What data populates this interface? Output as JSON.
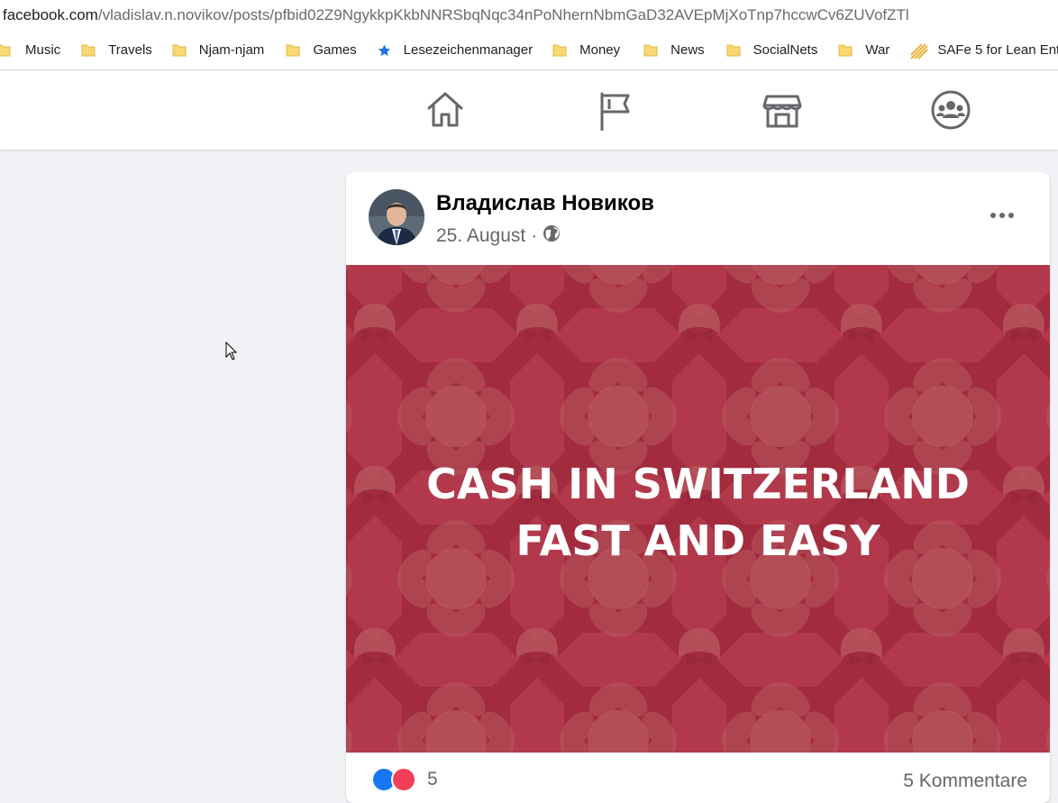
{
  "browser": {
    "url_host": "facebook.com",
    "url_path": "/vladislav.n.novikov/posts/pfbid02Z9NgykkpKkbNNRSbqNqc34nPoNhernNbmGaD32AVEpMjXoTnp7hccwCv6ZUVofZTl"
  },
  "bookmarks": [
    {
      "label": "Music",
      "icon": "folder-icon"
    },
    {
      "label": "Travels",
      "icon": "folder-icon"
    },
    {
      "label": "Njam-njam",
      "icon": "folder-icon"
    },
    {
      "label": "Games",
      "icon": "folder-icon"
    },
    {
      "label": "Lesezeichenmanager",
      "icon": "star-icon"
    },
    {
      "label": "Money",
      "icon": "folder-icon"
    },
    {
      "label": "News",
      "icon": "folder-icon"
    },
    {
      "label": "SocialNets",
      "icon": "folder-icon"
    },
    {
      "label": "War",
      "icon": "folder-icon"
    },
    {
      "label": "SAFe 5 for Lean Ent...",
      "icon": "safe-icon"
    }
  ],
  "nav": {
    "items": [
      "home-icon",
      "pages-flag-icon",
      "marketplace-icon",
      "groups-icon"
    ]
  },
  "post": {
    "author": "Владислав Новиков",
    "date": "25. August",
    "separator": "·",
    "privacy_icon": "globe-icon",
    "image_text_line1": "CASH IN SWITZERLAND",
    "image_text_line2": "FAST AND EASY",
    "reaction_count": "5",
    "comments_label": "5 Kommentare"
  },
  "colors": {
    "post_image_bg": "#a22b3e",
    "link_blue": "#1877f2",
    "love_red": "#f33e58",
    "page_bg": "#f0f2f5"
  }
}
